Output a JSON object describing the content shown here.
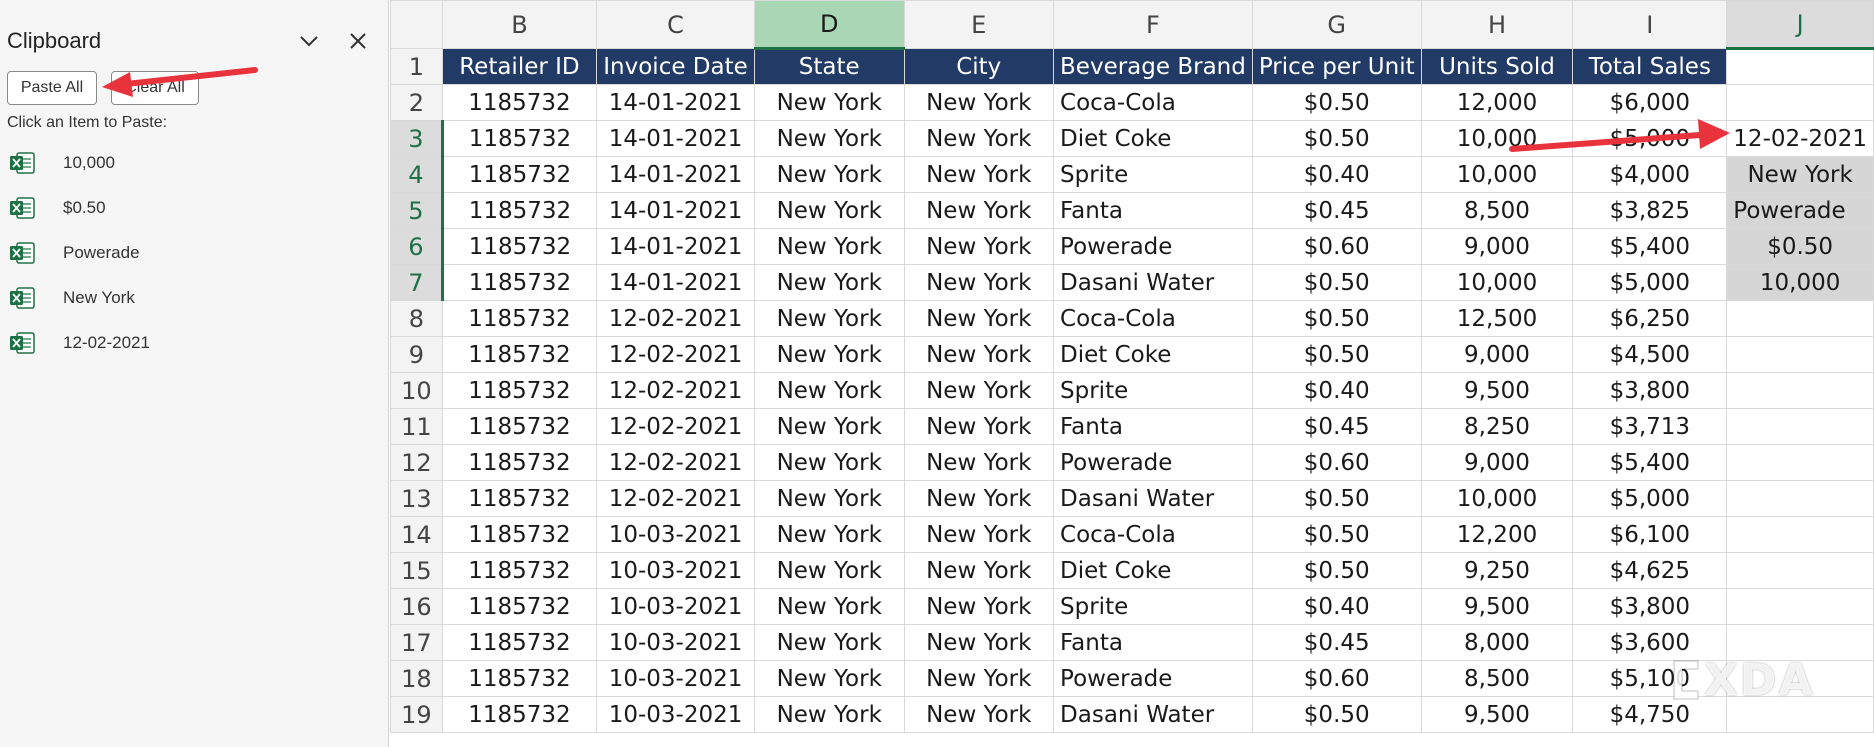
{
  "clipboard": {
    "title": "Clipboard",
    "paste_all_label": "Paste All",
    "clear_all_label": "Clear All",
    "hint": "Click an Item to Paste:",
    "items": [
      {
        "text": "10,000"
      },
      {
        "text": "$0.50"
      },
      {
        "text": "Powerade"
      },
      {
        "text": "New York"
      },
      {
        "text": "12-02-2021"
      }
    ]
  },
  "columns": [
    "B",
    "C",
    "D",
    "E",
    "F",
    "G",
    "H",
    "I",
    "J"
  ],
  "row_numbers": [
    "1",
    "2",
    "3",
    "4",
    "5",
    "6",
    "7",
    "8",
    "9",
    "10",
    "11",
    "12",
    "13",
    "14",
    "15",
    "16",
    "17",
    "18",
    "19"
  ],
  "table": {
    "headers": [
      "Retailer ID",
      "Invoice Date",
      "State",
      "City",
      "Beverage Brand",
      "Price per Unit",
      "Units Sold",
      "Total Sales"
    ],
    "rows": [
      [
        "1185732",
        "14-01-2021",
        "New York",
        "New York",
        "Coca-Cola",
        "$0.50",
        "12,000",
        "$6,000"
      ],
      [
        "1185732",
        "14-01-2021",
        "New York",
        "New York",
        "Diet Coke",
        "$0.50",
        "10,000",
        "$5,000"
      ],
      [
        "1185732",
        "14-01-2021",
        "New York",
        "New York",
        "Sprite",
        "$0.40",
        "10,000",
        "$4,000"
      ],
      [
        "1185732",
        "14-01-2021",
        "New York",
        "New York",
        "Fanta",
        "$0.45",
        "8,500",
        "$3,825"
      ],
      [
        "1185732",
        "14-01-2021",
        "New York",
        "New York",
        "Powerade",
        "$0.60",
        "9,000",
        "$5,400"
      ],
      [
        "1185732",
        "14-01-2021",
        "New York",
        "New York",
        "Dasani Water",
        "$0.50",
        "10,000",
        "$5,000"
      ],
      [
        "1185732",
        "12-02-2021",
        "New York",
        "New York",
        "Coca-Cola",
        "$0.50",
        "12,500",
        "$6,250"
      ],
      [
        "1185732",
        "12-02-2021",
        "New York",
        "New York",
        "Diet Coke",
        "$0.50",
        "9,000",
        "$4,500"
      ],
      [
        "1185732",
        "12-02-2021",
        "New York",
        "New York",
        "Sprite",
        "$0.40",
        "9,500",
        "$3,800"
      ],
      [
        "1185732",
        "12-02-2021",
        "New York",
        "New York",
        "Fanta",
        "$0.45",
        "8,250",
        "$3,713"
      ],
      [
        "1185732",
        "12-02-2021",
        "New York",
        "New York",
        "Powerade",
        "$0.60",
        "9,000",
        "$5,400"
      ],
      [
        "1185732",
        "12-02-2021",
        "New York",
        "New York",
        "Dasani Water",
        "$0.50",
        "10,000",
        "$5,000"
      ],
      [
        "1185732",
        "10-03-2021",
        "New York",
        "New York",
        "Coca-Cola",
        "$0.50",
        "12,200",
        "$6,100"
      ],
      [
        "1185732",
        "10-03-2021",
        "New York",
        "New York",
        "Diet Coke",
        "$0.50",
        "9,250",
        "$4,625"
      ],
      [
        "1185732",
        "10-03-2021",
        "New York",
        "New York",
        "Sprite",
        "$0.40",
        "9,500",
        "$3,800"
      ],
      [
        "1185732",
        "10-03-2021",
        "New York",
        "New York",
        "Fanta",
        "$0.45",
        "8,000",
        "$3,600"
      ],
      [
        "1185732",
        "10-03-2021",
        "New York",
        "New York",
        "Powerade",
        "$0.60",
        "8,500",
        "$5,100"
      ],
      [
        "1185732",
        "10-03-2021",
        "New York",
        "New York",
        "Dasani Water",
        "$0.50",
        "9,500",
        "$4,750"
      ]
    ]
  },
  "pasted_column_j": [
    "12-02-2021",
    "New York",
    "Powerade",
    "$0.50",
    "10,000"
  ],
  "watermark": "XDA",
  "colors": {
    "header_fill": "#223a66",
    "selection_green": "#1e7145",
    "annotation_arrow": "#e8323c"
  }
}
